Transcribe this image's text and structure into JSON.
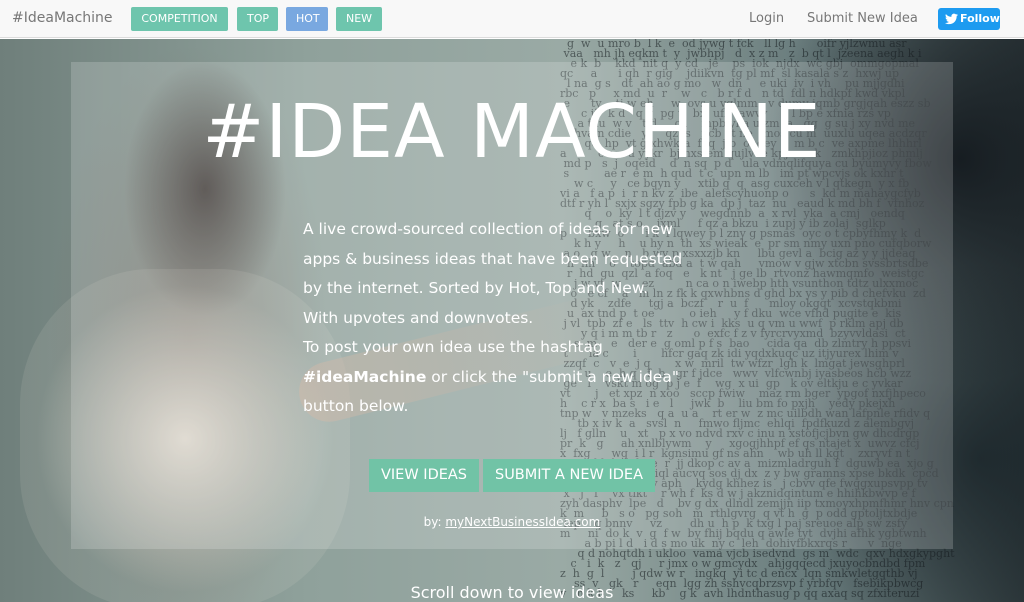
{
  "navbar": {
    "brand": "#IdeaMachine",
    "pills": [
      {
        "label": "COMPETITION",
        "active": false
      },
      {
        "label": "TOP",
        "active": false
      },
      {
        "label": "HOT",
        "active": true
      },
      {
        "label": "NEW",
        "active": false
      }
    ],
    "login_label": "Login",
    "submit_label": "Submit New Idea",
    "follow_label": "Follow",
    "follow_icon": "twitter-bird-icon"
  },
  "colors": {
    "pill_default": "#6ec5ad",
    "pill_active": "#79a8e0",
    "cta": "#71c3a6",
    "twitter": "#1d9bf0"
  },
  "hero": {
    "title": "#IDEA MACHINE",
    "description_lines": [
      "A live crowd-sourced collection of ideas for new",
      "apps & business ideas that have been requested",
      "by the internet. Sorted by Hot, Top and New.",
      "With upvotes and downvotes.",
      "To post your own idea use the hashtag"
    ],
    "hashtag": "#ideaMachine",
    "hashtag_suffix": " or click the \"submit a new idea\"",
    "last_line": "button below.",
    "view_ideas_label": "VIEW IDEAS",
    "submit_idea_label": "SUBMIT A NEW IDEA",
    "byline_prefix": "by: ",
    "byline_link": "myNextBusinessIdea.com",
    "scroll_hint": "Scroll down to view ideas"
  }
}
